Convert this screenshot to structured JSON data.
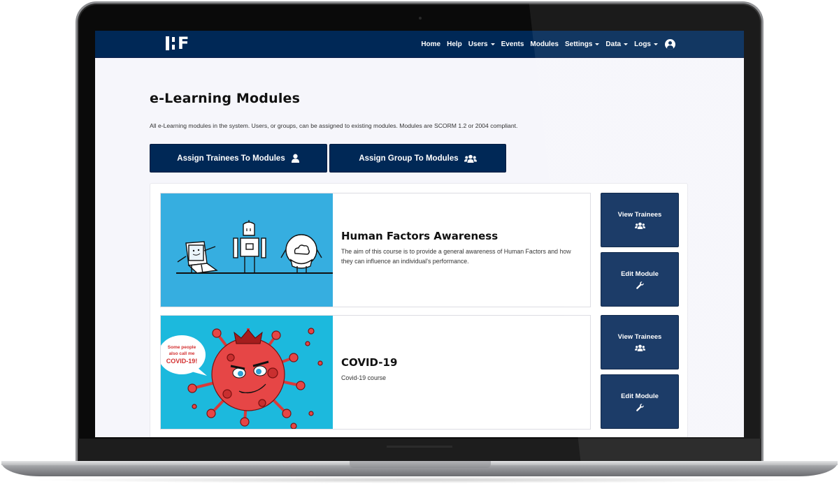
{
  "device": "laptop-mockup",
  "navbar": {
    "logo": "HF",
    "items": [
      {
        "label": "Home",
        "dropdown": false
      },
      {
        "label": "Help",
        "dropdown": false
      },
      {
        "label": "Users",
        "dropdown": true
      },
      {
        "label": "Events",
        "dropdown": false
      },
      {
        "label": "Modules",
        "dropdown": false
      },
      {
        "label": "Settings",
        "dropdown": true
      },
      {
        "label": "Data",
        "dropdown": true
      },
      {
        "label": "Logs",
        "dropdown": true
      }
    ],
    "account_icon": "user-circle-icon"
  },
  "page": {
    "title": "e-Learning Modules",
    "description": "All e-Learning modules in the system. Users, or groups, can be assigned to existing modules. Modules are SCORM 1.2 or 2004 compliant.",
    "actions": [
      {
        "label": "Assign Trainees To Modules",
        "icon": "user-icon"
      },
      {
        "label": "Assign Group To Modules",
        "icon": "users-icon"
      }
    ]
  },
  "modules": [
    {
      "title": "Human Factors Awareness",
      "description": "The aim of this course is to provide a general awareness of Human Factors and how they can influence an individual's performance.",
      "thumbnail": "cartoon laptop, robot and cloud characters on blue background",
      "view_label": "View Trainees",
      "edit_label": "Edit Module"
    },
    {
      "title": "COVID-19",
      "description": "Covid-19 course",
      "thumbnail": "cartoon red virus character with crown",
      "thumbnail_bubble": [
        "Some people",
        "also call me",
        "COVID-19!"
      ],
      "view_label": "View Trainees",
      "edit_label": "Edit Module"
    }
  ],
  "colors": {
    "primary": "#002856",
    "page_bg": "#f6f6fb",
    "thumb1_bg": "#36aee0",
    "thumb2_bg": "#1cb9dd"
  }
}
